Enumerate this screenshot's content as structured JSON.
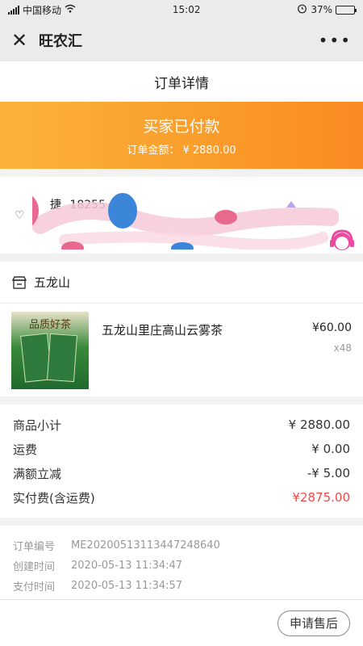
{
  "status_bar": {
    "carrier": "中国移动",
    "time": "15:02",
    "battery": "37%",
    "battery_level": 0.37
  },
  "navbar": {
    "close_icon": "close-icon",
    "title": "旺农汇",
    "more_icon": "more-icon"
  },
  "page_title": "订单详情",
  "banner": {
    "status": "买家已付款",
    "amount_text": "订单金额： ¥ 2880.00"
  },
  "address": {
    "name_visible": "捷",
    "phone_visible": "18255"
  },
  "shop": {
    "name": "五龙山"
  },
  "item": {
    "image_text": "品质好茶",
    "name": "五龙山里庄高山云雾茶",
    "price": "¥60.00",
    "quantity": "x48"
  },
  "summary": {
    "rows": [
      {
        "label": "商品小计",
        "value": "¥ 2880.00"
      },
      {
        "label": "运费",
        "value": "¥ 0.00"
      },
      {
        "label": "满额立减",
        "value": "-¥ 5.00"
      }
    ],
    "total_label": "实付费(含运费)",
    "total_value": "¥2875.00"
  },
  "order_info": {
    "rows": [
      {
        "label": "订单编号",
        "value": "ME20200513113447248640"
      },
      {
        "label": "创建时间",
        "value": "2020-05-13 11:34:47"
      },
      {
        "label": "支付时间",
        "value": "2020-05-13 11:34:57"
      }
    ]
  },
  "footer": {
    "after_sale_label": "申请售后"
  },
  "colors": {
    "banner_start": "#fbb33b",
    "banner_end": "#f98a21",
    "total_red": "#f04a4a"
  }
}
